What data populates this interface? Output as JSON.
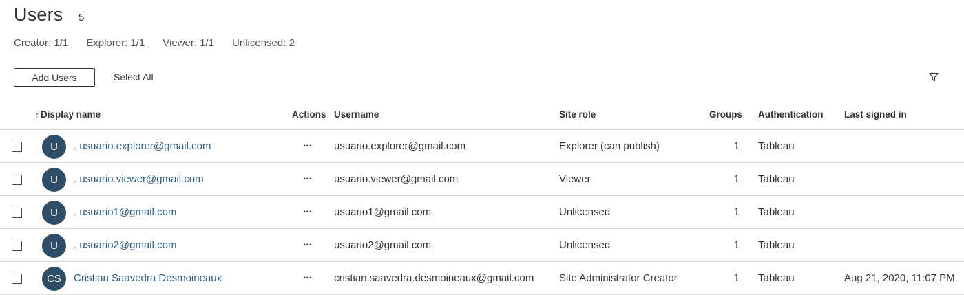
{
  "header": {
    "title": "Users",
    "count": "5"
  },
  "license_summary": [
    "Creator: 1/1",
    "Explorer: 1/1",
    "Viewer: 1/1",
    "Unlicensed: 2"
  ],
  "toolbar": {
    "add_users_label": "Add Users",
    "select_all_label": "Select All",
    "filter_icon": "filter-icon"
  },
  "table": {
    "sort_indicator": "↑",
    "columns": {
      "display_name": "Display name",
      "actions": "Actions",
      "username": "Username",
      "site_role": "Site role",
      "groups": "Groups",
      "authentication": "Authentication",
      "last_signed_in": "Last signed in"
    },
    "rows": [
      {
        "initials": "U",
        "display_name": ". usuario.explorer@gmail.com",
        "actions_icon": "•••",
        "username": "usuario.explorer@gmail.com",
        "site_role": "Explorer (can publish)",
        "groups": "1",
        "authentication": "Tableau",
        "last_signed_in": ""
      },
      {
        "initials": "U",
        "display_name": ". usuario.viewer@gmail.com",
        "actions_icon": "•••",
        "username": "usuario.viewer@gmail.com",
        "site_role": "Viewer",
        "groups": "1",
        "authentication": "Tableau",
        "last_signed_in": ""
      },
      {
        "initials": "U",
        "display_name": ". usuario1@gmail.com",
        "actions_icon": "•••",
        "username": "usuario1@gmail.com",
        "site_role": "Unlicensed",
        "groups": "1",
        "authentication": "Tableau",
        "last_signed_in": ""
      },
      {
        "initials": "U",
        "display_name": ". usuario2@gmail.com",
        "actions_icon": "•••",
        "username": "usuario2@gmail.com",
        "site_role": "Unlicensed",
        "groups": "1",
        "authentication": "Tableau",
        "last_signed_in": ""
      },
      {
        "initials": "CS",
        "display_name": "Cristian Saavedra Desmoineaux",
        "actions_icon": "•••",
        "username": "cristian.saavedra.desmoineaux@gmail.com",
        "site_role": "Site Administrator Creator",
        "groups": "1",
        "authentication": "Tableau",
        "last_signed_in": "Aug 21, 2020, 11:07 PM"
      }
    ]
  },
  "colors": {
    "avatar_bg": "#2e4e68",
    "link": "#2e5d86",
    "divider": "#d9d9d9"
  }
}
